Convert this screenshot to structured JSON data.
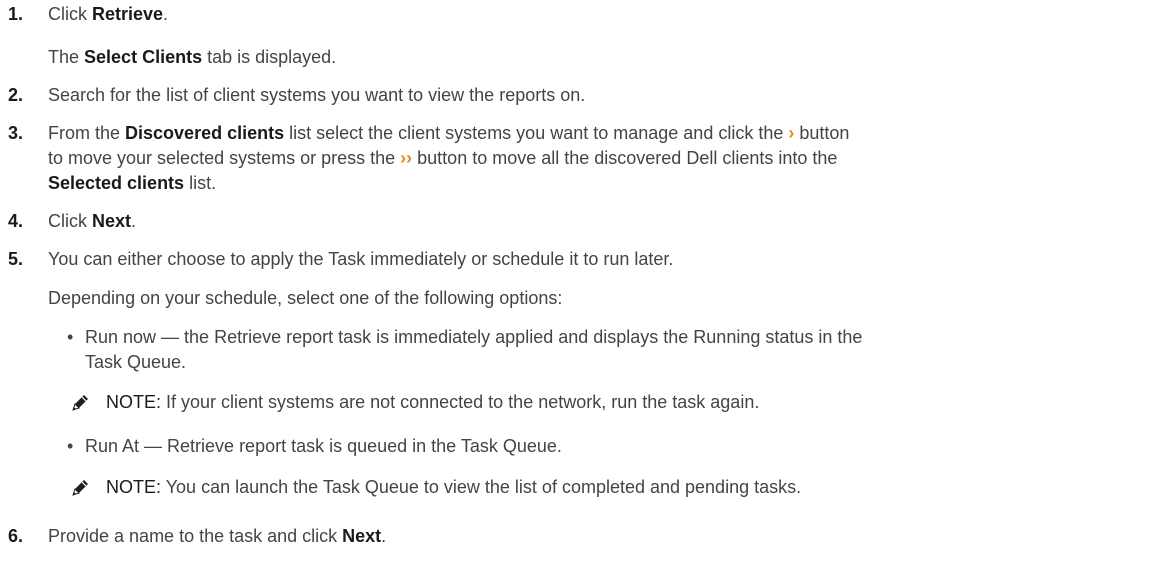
{
  "steps": [
    {
      "num": "1.",
      "parts": [
        "Click ",
        "Retrieve",
        "."
      ],
      "result": [
        "The ",
        "Select Clients",
        " tab is displayed."
      ]
    },
    {
      "num": "2.",
      "text": "Search for the list of client systems you want to view the reports on."
    },
    {
      "num": "3.",
      "l1": [
        "From the ",
        "Discovered clients",
        " list select the client systems you want to manage and click the ",
        "›",
        " button"
      ],
      "l2": [
        "to move your selected systems or press the ",
        "››",
        " button to move all the discovered Dell clients into the"
      ],
      "l3": [
        "Selected clients",
        " list."
      ]
    },
    {
      "num": "4.",
      "parts": [
        "Click ",
        "Next",
        "."
      ]
    },
    {
      "num": "5.",
      "text": "You can either choose to apply the Task immediately or schedule it to run later.",
      "intro": "Depending on your schedule, select one of the following options:",
      "bullets": [
        {
          "mark": "•",
          "l1": "Run now — the Retrieve report task is immediately applied and displays the Running status in the",
          "l2": "Task Queue."
        },
        {
          "mark": "•",
          "l1": "Run At — Retrieve report task is queued in the Task Queue."
        }
      ]
    },
    {
      "num": "6.",
      "parts": [
        "Provide a name to the task and click ",
        "Next",
        "."
      ]
    }
  ],
  "notes": [
    {
      "label": "NOTE:",
      "text": " If your client systems are not connected to the network, run the task again."
    },
    {
      "label": "NOTE:",
      "text": " You can launch the Task Queue to view the list of completed and pending tasks."
    }
  ],
  "colors": {
    "text": "#444444",
    "emphasis": "#1a1a1a",
    "chevron": "#e8891d"
  }
}
